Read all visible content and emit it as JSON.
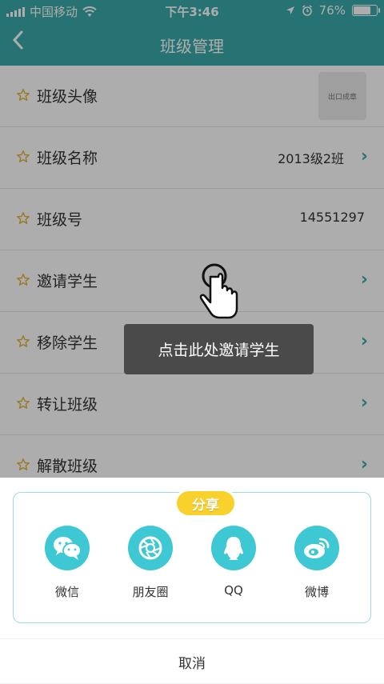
{
  "status_bar": {
    "carrier": "中国移动",
    "time": "下午3:46",
    "battery": "76%",
    "battery_level": 0.76
  },
  "navbar": {
    "back_icon": "chevron-left-icon",
    "title": "班级管理"
  },
  "rows": [
    {
      "label": "班级头像",
      "value": "",
      "avatar_text": "出口成章",
      "arrow": false
    },
    {
      "label": "班级名称",
      "value": "2013级2班",
      "arrow": true
    },
    {
      "label": "班级号",
      "value": "14551297",
      "arrow": false
    },
    {
      "label": "邀请学生",
      "value": "",
      "arrow": true
    },
    {
      "label": "移除学生",
      "value": "",
      "arrow": true
    },
    {
      "label": "转让班级",
      "value": "",
      "arrow": true
    },
    {
      "label": "解散班级",
      "value": "",
      "arrow": true
    }
  ],
  "tooltip": {
    "text": "点击此处邀请学生"
  },
  "share": {
    "badge": "分享",
    "items": [
      {
        "label": "微信",
        "icon": "wechat-icon"
      },
      {
        "label": "朋友圈",
        "icon": "moments-icon"
      },
      {
        "label": "QQ",
        "icon": "qq-icon"
      },
      {
        "label": "微博",
        "icon": "weibo-icon"
      }
    ],
    "cancel": "取消"
  },
  "colors": {
    "primary": "#3aa9a8",
    "share_icon_bg": "#3ec8d4",
    "badge": "#f8d12b",
    "star": "#e2b43c"
  }
}
